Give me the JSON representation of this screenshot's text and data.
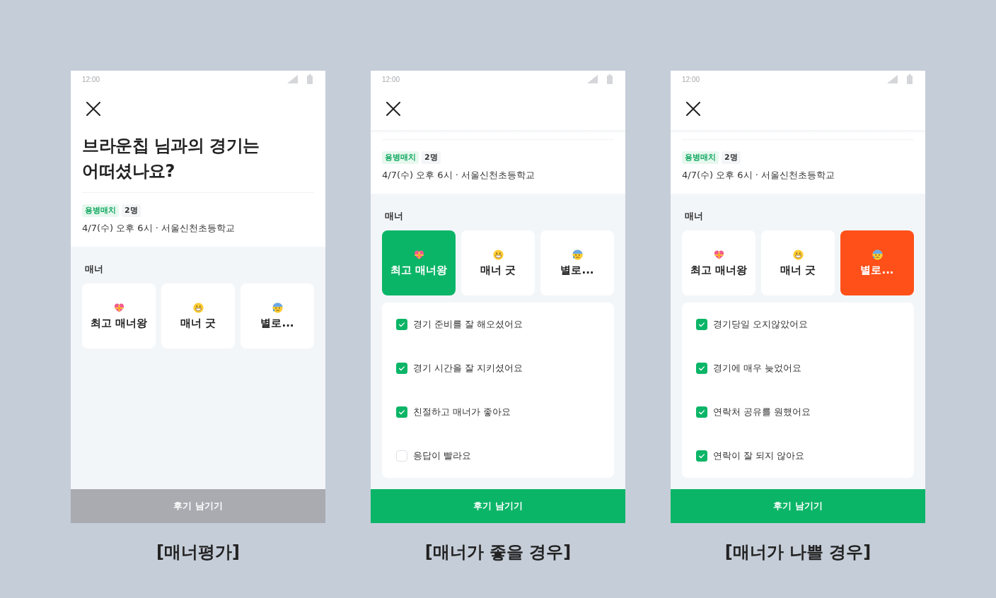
{
  "screens": [
    {
      "status_time": "12:00",
      "title": "브라운칩 님과의 경기는 어떠셨나요?",
      "tags": [
        {
          "kind": "match_type",
          "label": "용병매치"
        },
        {
          "kind": "headcount",
          "label": "2명"
        }
      ],
      "match_info": "4/7(수) 오후 6시 · 서울신천초등학교",
      "section_label": "매너",
      "ratings": [
        {
          "kind": "best",
          "label": "최고 매너왕",
          "selected": false
        },
        {
          "kind": "good",
          "label": "매너 굿",
          "selected": false
        },
        {
          "kind": "bad",
          "label": "별로...",
          "selected": false
        }
      ],
      "submit": {
        "label": "후기 남기기",
        "disabled": true
      },
      "caption": "[매너평가]"
    },
    {
      "status_time": "12:00",
      "tags": [
        {
          "kind": "match_type",
          "label": "용병매치"
        },
        {
          "kind": "headcount",
          "label": "2명"
        }
      ],
      "match_info": "4/7(수) 오후 6시 · 서울신천초등학교",
      "section_label": "매너",
      "ratings": [
        {
          "kind": "best",
          "label": "최고 매너왕",
          "selected": true
        },
        {
          "kind": "good",
          "label": "매너 굿",
          "selected": false
        },
        {
          "kind": "bad",
          "label": "별로...",
          "selected": false
        }
      ],
      "checklist": [
        {
          "label": "경기 준비를 잘 해오셨어요",
          "checked": true
        },
        {
          "label": "경기 시간을 잘 지키셨어요",
          "checked": true
        },
        {
          "label": "친절하고 매너가 좋아요",
          "checked": true
        },
        {
          "label": "응답이 빨라요",
          "checked": false
        }
      ],
      "submit": {
        "label": "후기 남기기",
        "disabled": false
      },
      "caption": "[매너가 좋을 경우]"
    },
    {
      "status_time": "12:00",
      "tags": [
        {
          "kind": "match_type",
          "label": "용병매치"
        },
        {
          "kind": "headcount",
          "label": "2명"
        }
      ],
      "match_info": "4/7(수) 오후 6시 · 서울신천초등학교",
      "section_label": "매너",
      "ratings": [
        {
          "kind": "best",
          "label": "최고 매너왕",
          "selected": false
        },
        {
          "kind": "good",
          "label": "매너 굿",
          "selected": false
        },
        {
          "kind": "bad",
          "label": "별로...",
          "selected": true
        }
      ],
      "checklist": [
        {
          "label": "경기당일 오지않았어요",
          "checked": true
        },
        {
          "label": "경기에 매우 늦었어요",
          "checked": true
        },
        {
          "label": "연락처 공유를 원했어요",
          "checked": true
        },
        {
          "label": "연락이 잘 되지 않아요",
          "checked": true
        }
      ],
      "submit": {
        "label": "후기 남기기",
        "disabled": false
      },
      "caption": "[매너가 나쁠 경우]"
    }
  ]
}
